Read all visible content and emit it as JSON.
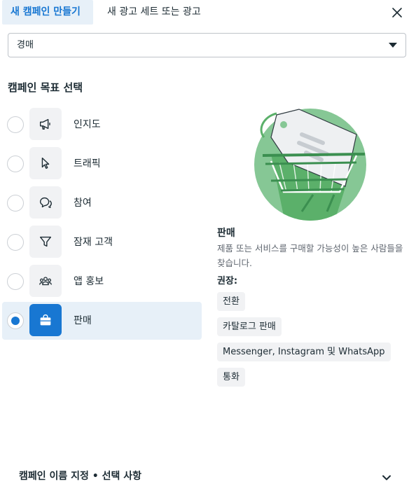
{
  "tabs": [
    {
      "label": "새 캠페인 만들기"
    },
    {
      "label": "새 광고 세트 또는 광고"
    }
  ],
  "buying_type": {
    "selected": "경매"
  },
  "objective_section": {
    "heading": "캠페인 목표 선택"
  },
  "objectives": [
    {
      "label": "인지도",
      "icon": "megaphone-icon",
      "selected": false
    },
    {
      "label": "트래픽",
      "icon": "cursor-icon",
      "selected": false
    },
    {
      "label": "참여",
      "icon": "chat-bubbles-icon",
      "selected": false
    },
    {
      "label": "잠재 고객",
      "icon": "funnel-icon",
      "selected": false
    },
    {
      "label": "앱 홍보",
      "icon": "people-icon",
      "selected": false
    },
    {
      "label": "판매",
      "icon": "shopping-bag-icon",
      "selected": true
    }
  ],
  "detail": {
    "title": "판매",
    "description": "제품 또는 서비스를 구매할 가능성이 높은 사람들을 찾습니다.",
    "recommended_heading": "권장:",
    "recommended": [
      "전환",
      "카탈로그 판매",
      "Messenger, Instagram 및 WhatsApp",
      "통화"
    ]
  },
  "footer": {
    "label": "캠페인 이름 지정 • 선택 사항"
  },
  "colors": {
    "accent": "#1877d2",
    "selected_bg": "#e7f0f8",
    "illustration_green": "#86c795"
  }
}
